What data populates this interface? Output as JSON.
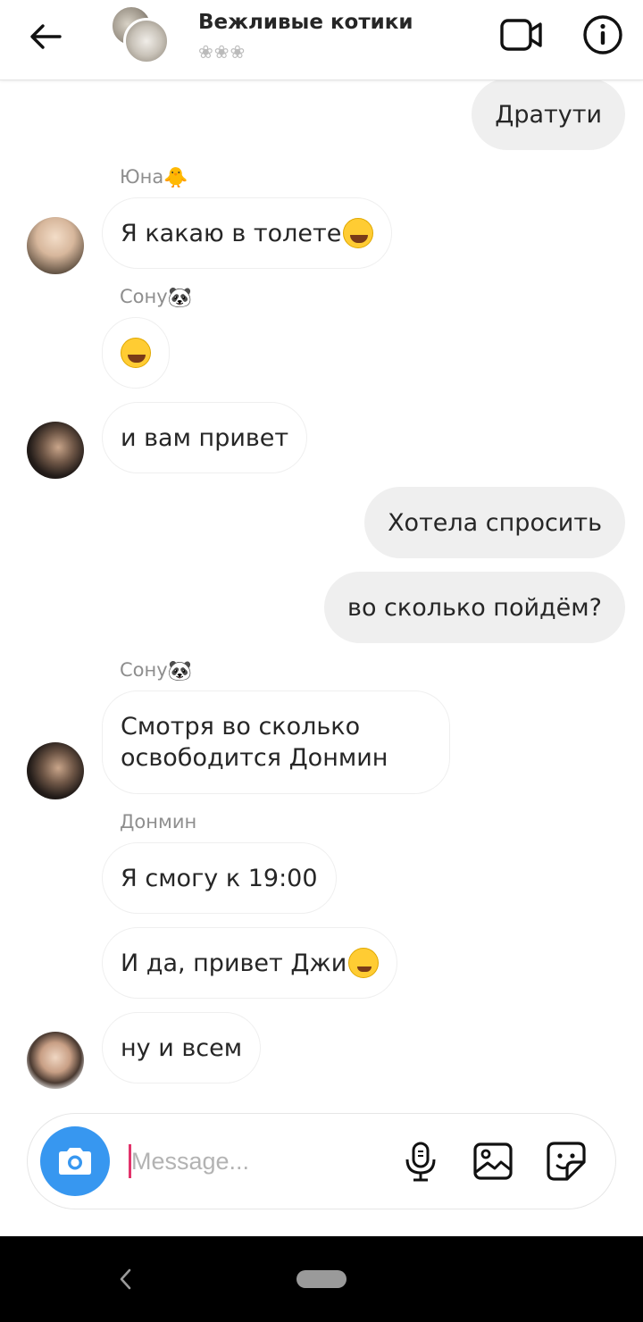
{
  "header": {
    "title": "Вежливые котики",
    "subtitle": "❀❀❀"
  },
  "messages": {
    "m1": "Дратути",
    "yuna_name": "Юна",
    "yuna_emoji": "🐥",
    "m2": "Я какаю в толете",
    "sonu_name": "Сону",
    "sonu_emoji": "🐼",
    "m4": "и вам привет",
    "m5": "Хотела спросить",
    "m6": "во сколько пойдём?",
    "sonu_name2": "Сону",
    "m7": "Смотря во сколько освободится Донмин",
    "donmin_name": "Донмин",
    "m8": "Я смогу к 19:00",
    "m9": "И да, привет Джи",
    "m10": "ну и всем"
  },
  "composer": {
    "placeholder": "Message..."
  },
  "colors": {
    "accent": "#3797f0",
    "outgoing_bubble": "#efefef",
    "cursor": "#e2336b"
  },
  "icons": [
    "arrow-left-icon",
    "video-camera-icon",
    "info-icon",
    "camera-icon",
    "microphone-icon",
    "image-icon",
    "sticker-icon",
    "nav-back-icon"
  ]
}
